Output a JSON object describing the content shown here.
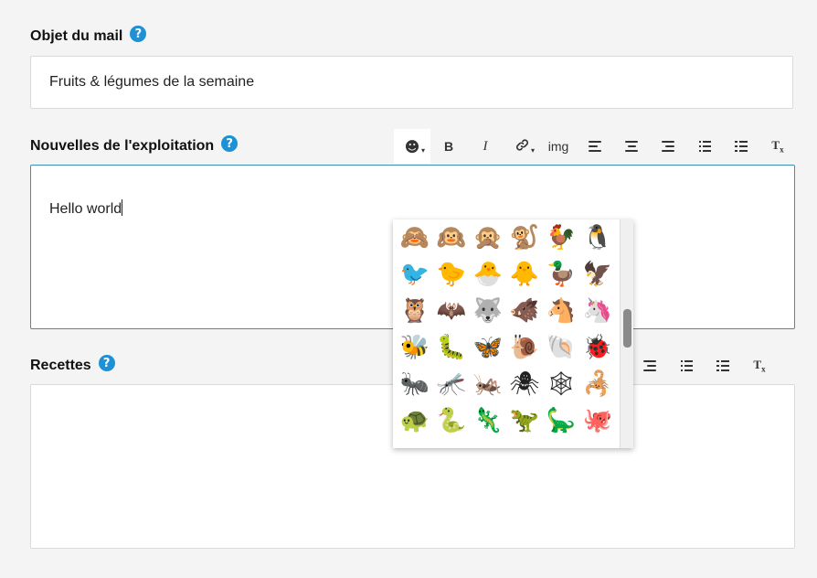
{
  "subject": {
    "label": "Objet du mail",
    "value": "Fruits & légumes de la semaine"
  },
  "news": {
    "label": "Nouvelles de l'exploitation",
    "content": "Hello world"
  },
  "recipes": {
    "label": "Recettes",
    "content": ""
  },
  "toolbar": {
    "emoji_glyph": "☻",
    "bold": "B",
    "italic": "I",
    "link_glyph": "🔗",
    "img": "img",
    "clear": "T",
    "clear_sub": "x"
  },
  "help_glyph": "?",
  "emoji_picker": {
    "rows": [
      [
        "🙈",
        "🙉",
        "🙊",
        "🐒",
        "🐓",
        "🐧"
      ],
      [
        "🐦",
        "🐤",
        "🐣",
        "🐥",
        "🦆",
        "🦅"
      ],
      [
        "🦉",
        "🦇",
        "🐺",
        "🐗",
        "🐴",
        "🦄"
      ],
      [
        "🐝",
        "🐛",
        "🦋",
        "🐌",
        "🐚",
        "🐞"
      ],
      [
        "🐜",
        "🦟",
        "🦗",
        "🕷",
        "🕸",
        "🦂"
      ],
      [
        "🐢",
        "🐍",
        "🦎",
        "🦖",
        "🦕",
        "🐙"
      ]
    ],
    "partial_row": [
      "🦑",
      "🦐",
      "🦞",
      "🦀",
      "🐡",
      "🐠"
    ]
  },
  "colors": {
    "help": "#1e90d6",
    "focus_border": "#3a8fb7"
  }
}
